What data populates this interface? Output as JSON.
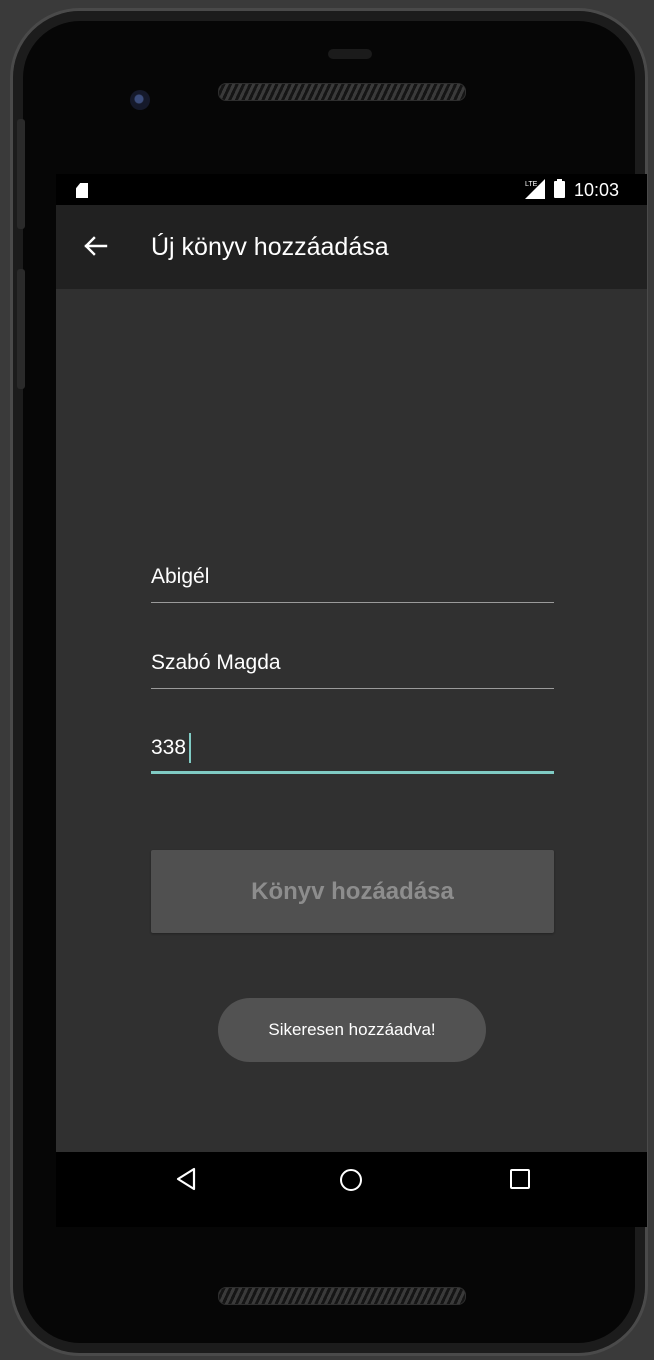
{
  "status_bar": {
    "time": "10:03",
    "icons": [
      "sd-card-icon",
      "signal-icon",
      "battery-icon"
    ]
  },
  "app_bar": {
    "back_icon": "arrow-back-icon",
    "title": "Új könyv hozzáadása"
  },
  "form": {
    "title_field": {
      "value": "Abigél",
      "focused": false
    },
    "author_field": {
      "value": "Szabó Magda",
      "focused": false
    },
    "pages_field": {
      "value": "338",
      "focused": true
    },
    "submit_label": "Könyv hozáadása",
    "submit_enabled": false
  },
  "toast": {
    "message": "Sikeresen hozzáadva!"
  },
  "nav_bar": {
    "icons": [
      "nav-back-icon",
      "nav-home-icon",
      "nav-recents-icon"
    ]
  },
  "colors": {
    "accent": "#80cbc4",
    "app_bar": "#212121",
    "background": "#303030",
    "button": "#505050",
    "toast": "#525252"
  }
}
